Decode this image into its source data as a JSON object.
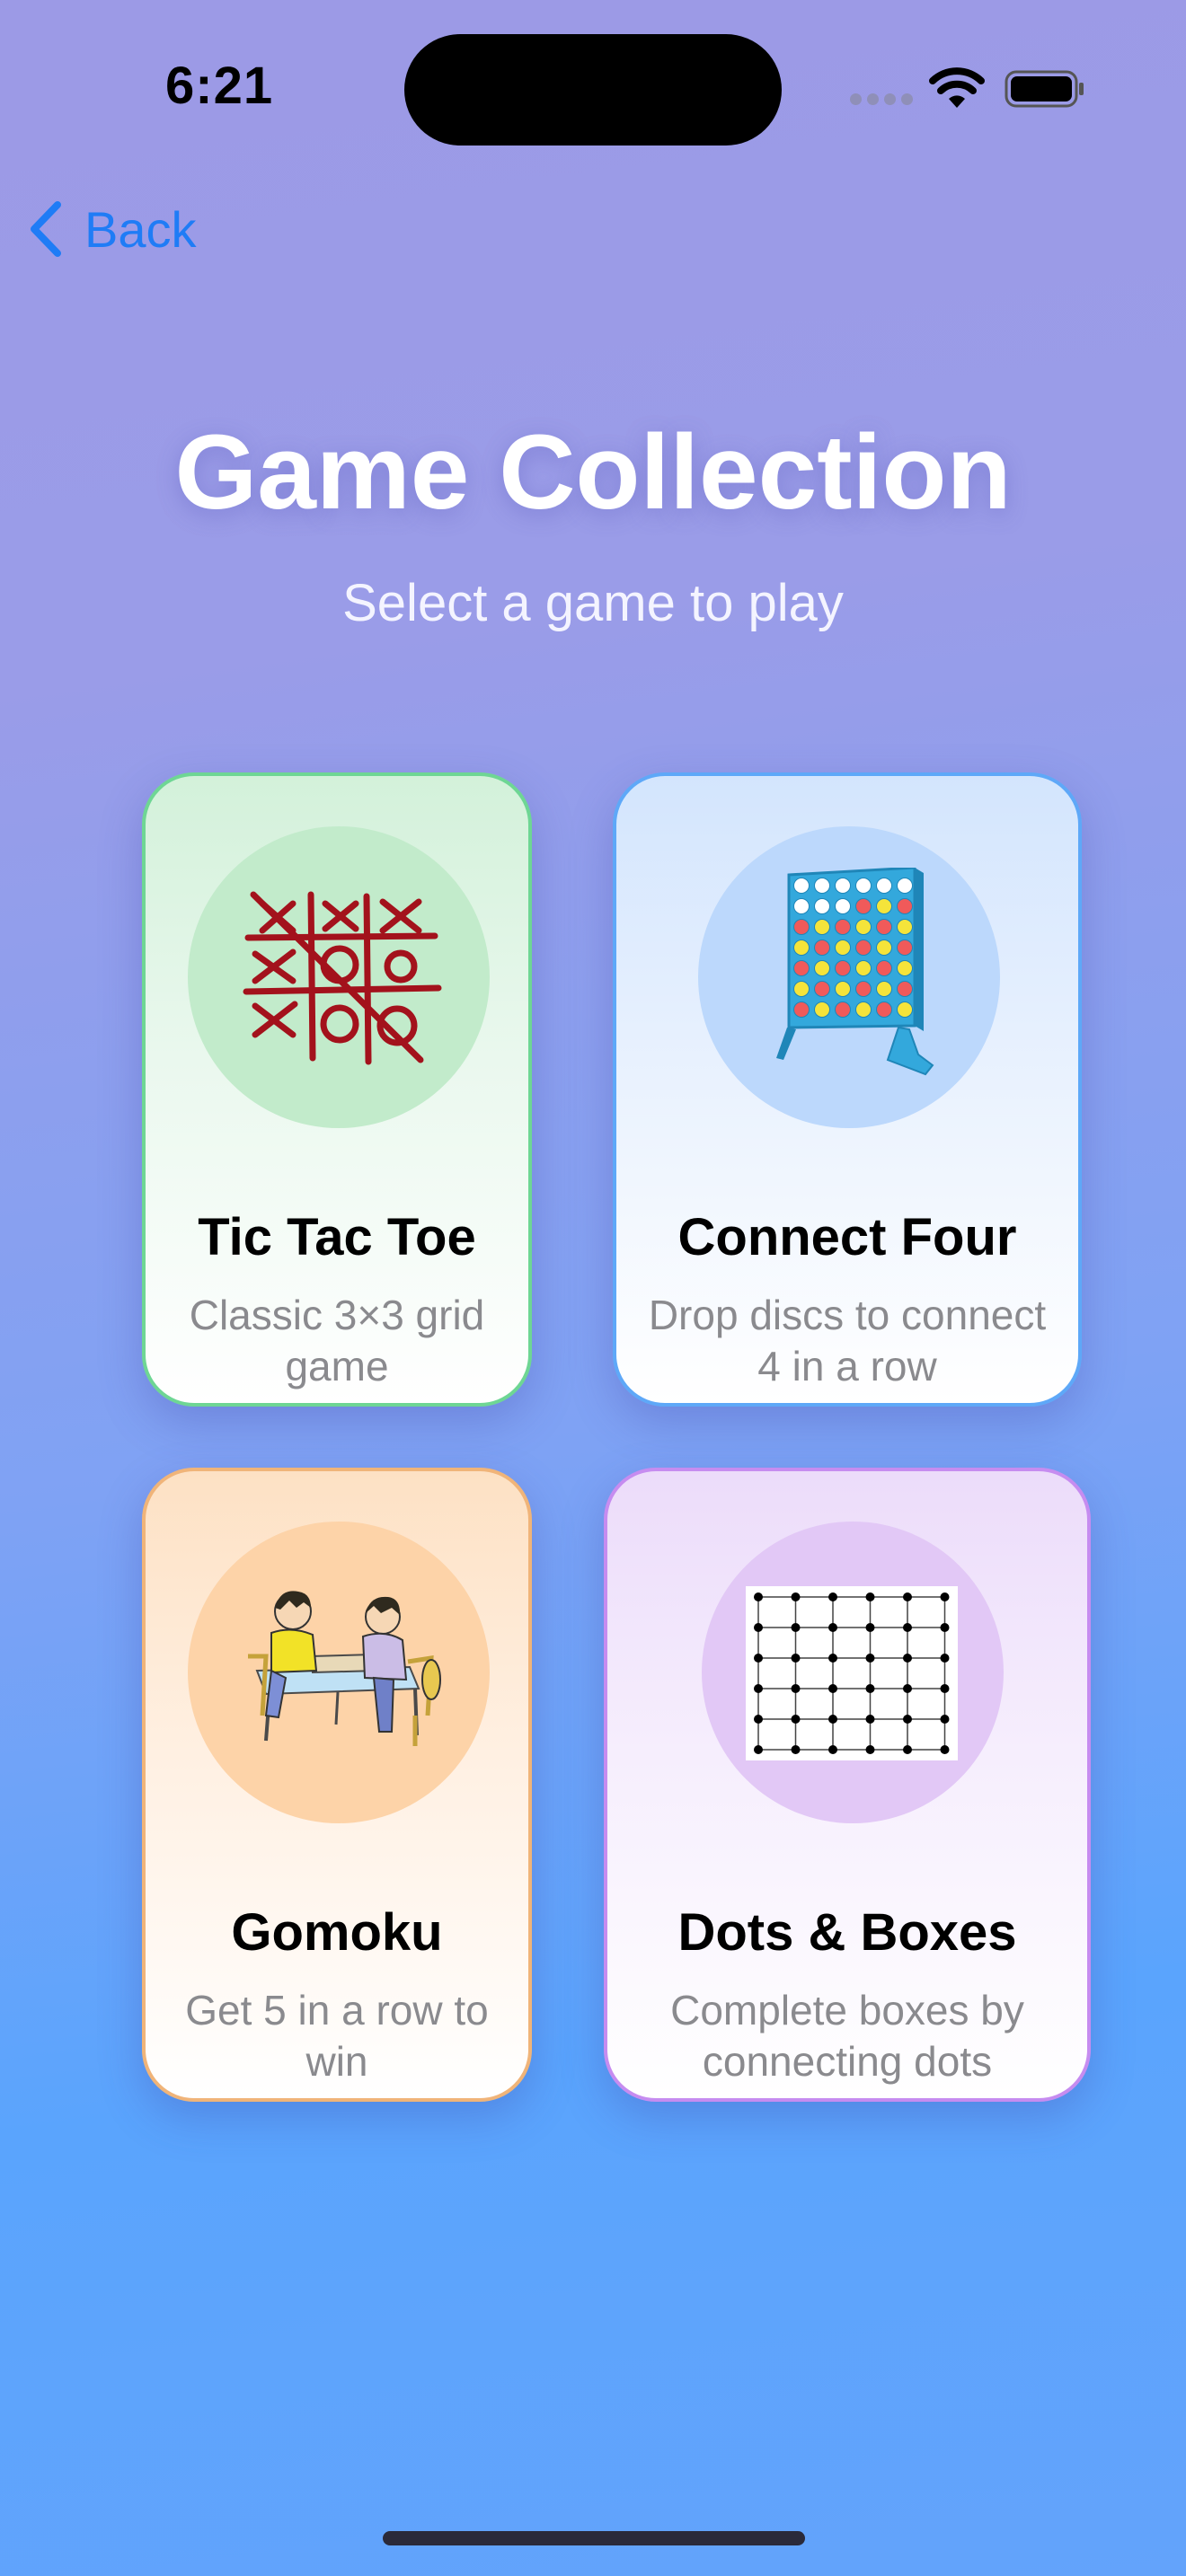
{
  "status_bar": {
    "time": "6:21"
  },
  "nav": {
    "back_label": "Back"
  },
  "header": {
    "title": "Game Collection",
    "subtitle": "Select a game to play"
  },
  "games": [
    {
      "name": "Tic Tac Toe",
      "description": "Classic 3×3 grid game",
      "accent": "#6ed694",
      "icon": "tic-tac-toe-icon"
    },
    {
      "name": "Connect Four",
      "description": "Drop discs to connect 4 in a row",
      "accent": "#5ea8f8",
      "icon": "connect-four-icon"
    },
    {
      "name": "Gomoku",
      "description": "Get 5 in a row to win",
      "accent": "#f0b479",
      "icon": "gomoku-players-icon"
    },
    {
      "name": "Dots & Boxes",
      "description": "Complete boxes by connecting dots",
      "accent": "#c68cf0",
      "icon": "dots-and-boxes-icon"
    }
  ]
}
